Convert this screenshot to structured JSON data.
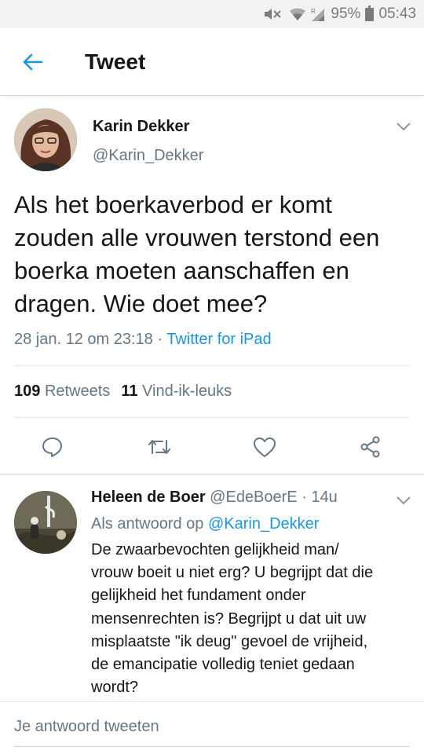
{
  "status_bar": {
    "battery": "95%",
    "time": "05:43",
    "icons": [
      "mute-icon",
      "wifi-icon",
      "signal-icon",
      "battery-icon"
    ]
  },
  "app_bar": {
    "title": "Tweet",
    "back_icon": "arrow-left-icon"
  },
  "tweet": {
    "author_name": "Karin Dekker",
    "author_handle": "@Karin_Dekker",
    "text": "Als het boerkaverbod er komt zouden alle vrouwen terstond een boerka moeten aanschaffen en dragen. Wie doet mee?",
    "timestamp": "28 jan. 12 om 23:18",
    "separator": " · ",
    "via": "Twitter for iPad",
    "retweet_count": "109",
    "retweet_label": "Retweets",
    "like_count": "11",
    "like_label": "Vind-ik-leuks",
    "actions": [
      "reply-icon",
      "retweet-icon",
      "like-icon",
      "share-icon"
    ]
  },
  "reply": {
    "name": "Heleen de Boer",
    "handle": "@EdeBoerE",
    "separator": " · ",
    "time": "14u",
    "reply_to_prefix": "Als antwoord op ",
    "reply_to_handle": "@Karin_Dekker",
    "lines": [
      "De zwaarbevochten gelijkheid man/",
      "vrouw boeit u niet erg? U begrijpt dat die",
      "gelijkheid het fundament onder",
      "mensenrechten is? Begrijpt u dat uit uw",
      "misplaatste \"ik deug\" gevoel de vrijheid,",
      "de emancipatie volledig teniet gedaan",
      "wordt?"
    ]
  },
  "compose": {
    "placeholder": "Je antwoord tweeten"
  },
  "colors": {
    "accent": "#1d94e0",
    "secondary_text": "#657786",
    "primary_text": "#14171a"
  }
}
